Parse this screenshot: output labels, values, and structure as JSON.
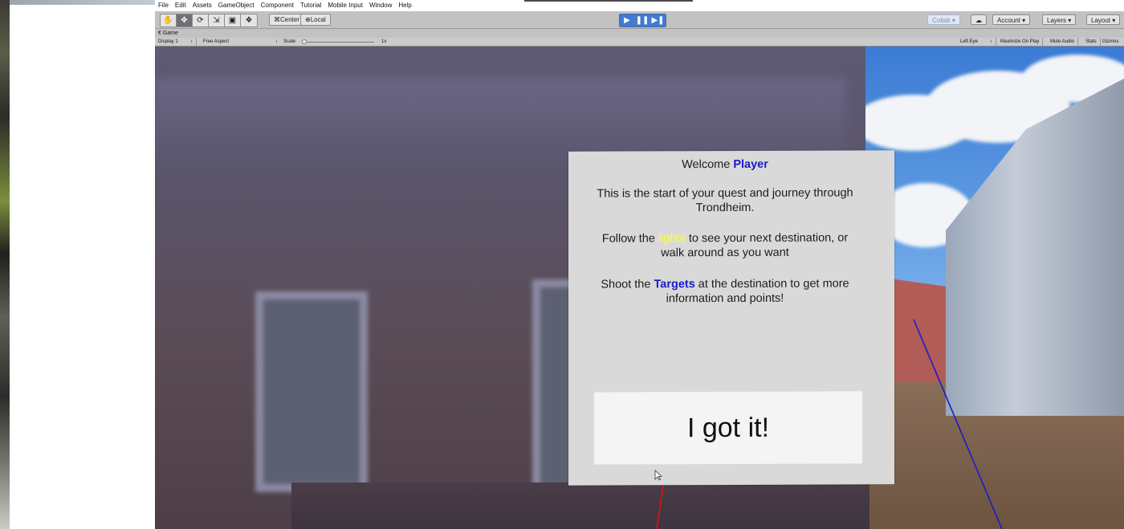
{
  "menu": [
    "File",
    "Edit",
    "Assets",
    "GameObject",
    "Component",
    "Tutorial",
    "Mobile Input",
    "Window",
    "Help"
  ],
  "toolbar": {
    "transform_tools": [
      "hand-tool",
      "move-tool",
      "rotate-tool",
      "scale-tool",
      "rect-tool",
      "transform-tool"
    ],
    "pivot_label": "⌘Center",
    "space_label": "⊕Local",
    "collab_label": "Collab ▾",
    "account_label": "Account ▾",
    "layers_label": "Layers ▾",
    "layout_label": "Layout ▾"
  },
  "game_tab": {
    "label": "€ Game"
  },
  "gamebar": {
    "display": "Display 1",
    "display_arrow": "↕",
    "aspect": "Free Aspect",
    "aspect_arrow": "↕",
    "scale_label": "Scale",
    "scale_value": "1x",
    "eye": "Left Eye",
    "eye_arrow": "↕",
    "maximize": "Maximize On Play",
    "mute": "Mute Audio",
    "stats": "Stats",
    "gizmos": "Gizmos"
  },
  "dialog": {
    "welcome_prefix": "Welcome ",
    "welcome_name": "Player",
    "line1": "This is the start of your quest and journey through",
    "line1b": "Trondheim.",
    "follow_prefix": "Follow the ",
    "follow_highlight": "lights",
    "follow_suffix": " to see your next destination, or",
    "follow_b": "walk around as you want",
    "shoot_prefix": "Shoot the ",
    "shoot_highlight": "Targets",
    "shoot_suffix": " at the destination to get more",
    "shoot_b": "information and points!",
    "button_label": "I got it!"
  },
  "colors": {
    "highlight_blue": "#1a1acc",
    "highlight_yellow": "#ffff33",
    "play_active": "#3f7ad6"
  }
}
